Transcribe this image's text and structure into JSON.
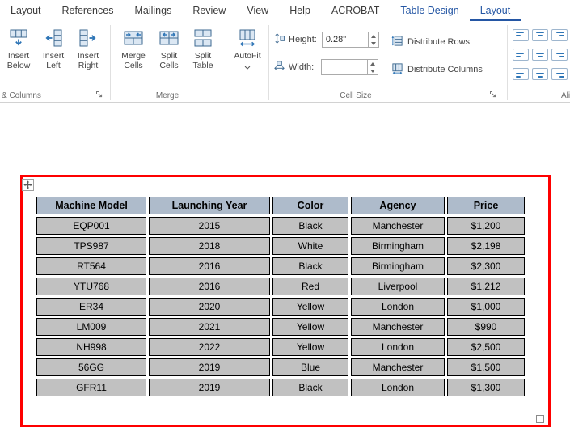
{
  "ribbon": {
    "tabs": [
      {
        "id": "layout",
        "label": "Layout"
      },
      {
        "id": "references",
        "label": "References"
      },
      {
        "id": "mailings",
        "label": "Mailings"
      },
      {
        "id": "review",
        "label": "Review"
      },
      {
        "id": "view",
        "label": "View"
      },
      {
        "id": "help",
        "label": "Help"
      },
      {
        "id": "acrobat",
        "label": "ACROBAT"
      },
      {
        "id": "table-design",
        "label": "Table Design",
        "contextual": true
      },
      {
        "id": "table-layout",
        "label": "Layout",
        "contextual": true,
        "active": true
      }
    ],
    "rows_columns": {
      "group_label": "& Columns",
      "insert_below": "Insert Below",
      "insert_left": "Insert Left",
      "insert_right": "Insert Right"
    },
    "merge": {
      "group_label": "Merge",
      "merge_cells": "Merge Cells",
      "split_cells": "Split Cells",
      "split_table": "Split Table"
    },
    "autofit": {
      "label": "AutoFit"
    },
    "cell_size": {
      "group_label": "Cell Size",
      "height_label": "Height:",
      "height_value": "0.28\"",
      "width_label": "Width:",
      "width_value": "",
      "distribute_rows": "Distribute Rows",
      "distribute_columns": "Distribute Columns"
    },
    "alignment": {
      "group_label": "Ali",
      "buttons": [
        "top-left",
        "top-center",
        "top-right",
        "center-left",
        "center-center",
        "center-right",
        "bottom-left",
        "bottom-center",
        "bottom-right"
      ]
    }
  },
  "document": {
    "table": {
      "headers": [
        "Machine Model",
        "Launching Year",
        "Color",
        "Agency",
        "Price"
      ],
      "rows": [
        [
          "EQP001",
          "2015",
          "Black",
          "Manchester",
          "$1,200"
        ],
        [
          "TPS987",
          "2018",
          "White",
          "Birmingham",
          "$2,198"
        ],
        [
          "RT564",
          "2016",
          "Black",
          "Birmingham",
          "$2,300"
        ],
        [
          "YTU768",
          "2016",
          "Red",
          "Liverpool",
          "$1,212"
        ],
        [
          "ER34",
          "2020",
          "Yellow",
          "London",
          "$1,000"
        ],
        [
          "LM009",
          "2021",
          "Yellow",
          "Manchester",
          "$990"
        ],
        [
          "NH998",
          "2022",
          "Yellow",
          "London",
          "$2,500"
        ],
        [
          "56GG",
          "2019",
          "Blue",
          "Manchester",
          "$1,500"
        ],
        [
          "GFR11",
          "2019",
          "Black",
          "London",
          "$1,300"
        ]
      ]
    }
  },
  "colors": {
    "accent": "#2456a4",
    "header_fill": "#aebbcb",
    "cell_fill": "#c1c1c1",
    "selection_border": "#fe0000"
  }
}
